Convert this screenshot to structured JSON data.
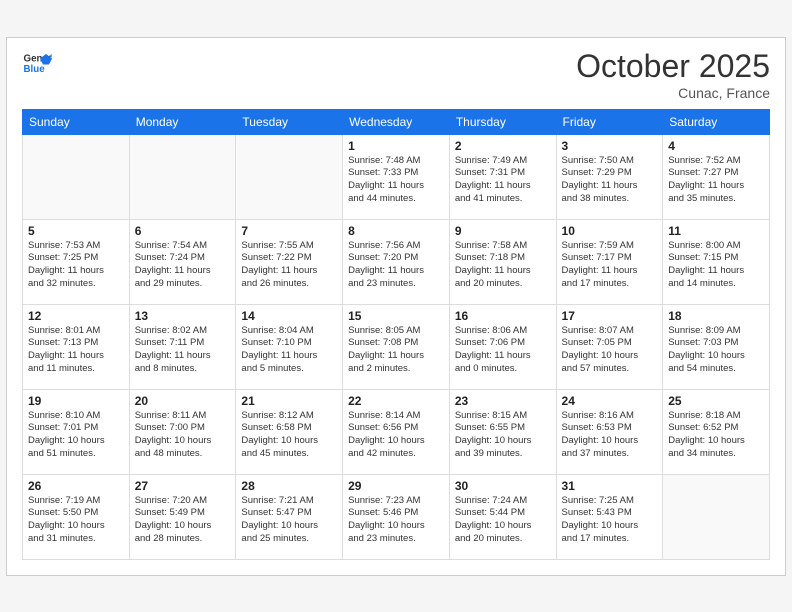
{
  "header": {
    "logo_general": "General",
    "logo_blue": "Blue",
    "month_title": "October 2025",
    "location": "Cunac, France"
  },
  "weekdays": [
    "Sunday",
    "Monday",
    "Tuesday",
    "Wednesday",
    "Thursday",
    "Friday",
    "Saturday"
  ],
  "weeks": [
    [
      {
        "day": "",
        "info": ""
      },
      {
        "day": "",
        "info": ""
      },
      {
        "day": "",
        "info": ""
      },
      {
        "day": "1",
        "info": "Sunrise: 7:48 AM\nSunset: 7:33 PM\nDaylight: 11 hours\nand 44 minutes."
      },
      {
        "day": "2",
        "info": "Sunrise: 7:49 AM\nSunset: 7:31 PM\nDaylight: 11 hours\nand 41 minutes."
      },
      {
        "day": "3",
        "info": "Sunrise: 7:50 AM\nSunset: 7:29 PM\nDaylight: 11 hours\nand 38 minutes."
      },
      {
        "day": "4",
        "info": "Sunrise: 7:52 AM\nSunset: 7:27 PM\nDaylight: 11 hours\nand 35 minutes."
      }
    ],
    [
      {
        "day": "5",
        "info": "Sunrise: 7:53 AM\nSunset: 7:25 PM\nDaylight: 11 hours\nand 32 minutes."
      },
      {
        "day": "6",
        "info": "Sunrise: 7:54 AM\nSunset: 7:24 PM\nDaylight: 11 hours\nand 29 minutes."
      },
      {
        "day": "7",
        "info": "Sunrise: 7:55 AM\nSunset: 7:22 PM\nDaylight: 11 hours\nand 26 minutes."
      },
      {
        "day": "8",
        "info": "Sunrise: 7:56 AM\nSunset: 7:20 PM\nDaylight: 11 hours\nand 23 minutes."
      },
      {
        "day": "9",
        "info": "Sunrise: 7:58 AM\nSunset: 7:18 PM\nDaylight: 11 hours\nand 20 minutes."
      },
      {
        "day": "10",
        "info": "Sunrise: 7:59 AM\nSunset: 7:17 PM\nDaylight: 11 hours\nand 17 minutes."
      },
      {
        "day": "11",
        "info": "Sunrise: 8:00 AM\nSunset: 7:15 PM\nDaylight: 11 hours\nand 14 minutes."
      }
    ],
    [
      {
        "day": "12",
        "info": "Sunrise: 8:01 AM\nSunset: 7:13 PM\nDaylight: 11 hours\nand 11 minutes."
      },
      {
        "day": "13",
        "info": "Sunrise: 8:02 AM\nSunset: 7:11 PM\nDaylight: 11 hours\nand 8 minutes."
      },
      {
        "day": "14",
        "info": "Sunrise: 8:04 AM\nSunset: 7:10 PM\nDaylight: 11 hours\nand 5 minutes."
      },
      {
        "day": "15",
        "info": "Sunrise: 8:05 AM\nSunset: 7:08 PM\nDaylight: 11 hours\nand 2 minutes."
      },
      {
        "day": "16",
        "info": "Sunrise: 8:06 AM\nSunset: 7:06 PM\nDaylight: 11 hours\nand 0 minutes."
      },
      {
        "day": "17",
        "info": "Sunrise: 8:07 AM\nSunset: 7:05 PM\nDaylight: 10 hours\nand 57 minutes."
      },
      {
        "day": "18",
        "info": "Sunrise: 8:09 AM\nSunset: 7:03 PM\nDaylight: 10 hours\nand 54 minutes."
      }
    ],
    [
      {
        "day": "19",
        "info": "Sunrise: 8:10 AM\nSunset: 7:01 PM\nDaylight: 10 hours\nand 51 minutes."
      },
      {
        "day": "20",
        "info": "Sunrise: 8:11 AM\nSunset: 7:00 PM\nDaylight: 10 hours\nand 48 minutes."
      },
      {
        "day": "21",
        "info": "Sunrise: 8:12 AM\nSunset: 6:58 PM\nDaylight: 10 hours\nand 45 minutes."
      },
      {
        "day": "22",
        "info": "Sunrise: 8:14 AM\nSunset: 6:56 PM\nDaylight: 10 hours\nand 42 minutes."
      },
      {
        "day": "23",
        "info": "Sunrise: 8:15 AM\nSunset: 6:55 PM\nDaylight: 10 hours\nand 39 minutes."
      },
      {
        "day": "24",
        "info": "Sunrise: 8:16 AM\nSunset: 6:53 PM\nDaylight: 10 hours\nand 37 minutes."
      },
      {
        "day": "25",
        "info": "Sunrise: 8:18 AM\nSunset: 6:52 PM\nDaylight: 10 hours\nand 34 minutes."
      }
    ],
    [
      {
        "day": "26",
        "info": "Sunrise: 7:19 AM\nSunset: 5:50 PM\nDaylight: 10 hours\nand 31 minutes."
      },
      {
        "day": "27",
        "info": "Sunrise: 7:20 AM\nSunset: 5:49 PM\nDaylight: 10 hours\nand 28 minutes."
      },
      {
        "day": "28",
        "info": "Sunrise: 7:21 AM\nSunset: 5:47 PM\nDaylight: 10 hours\nand 25 minutes."
      },
      {
        "day": "29",
        "info": "Sunrise: 7:23 AM\nSunset: 5:46 PM\nDaylight: 10 hours\nand 23 minutes."
      },
      {
        "day": "30",
        "info": "Sunrise: 7:24 AM\nSunset: 5:44 PM\nDaylight: 10 hours\nand 20 minutes."
      },
      {
        "day": "31",
        "info": "Sunrise: 7:25 AM\nSunset: 5:43 PM\nDaylight: 10 hours\nand 17 minutes."
      },
      {
        "day": "",
        "info": ""
      }
    ]
  ]
}
